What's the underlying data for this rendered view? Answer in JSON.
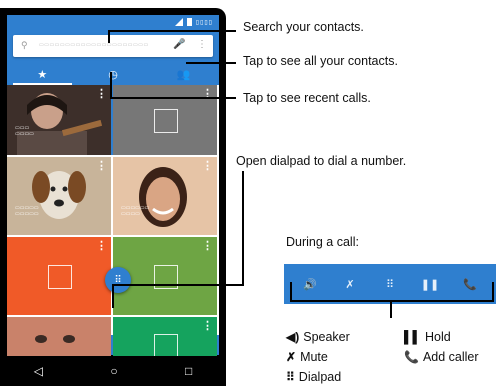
{
  "phone": {
    "statusbar": {
      "time": "▯▯▯▯"
    },
    "search": {
      "placeholder": "▭▭▭▭▭▭▭▭▭▭▭▭▭▭▭▭▭▭▭▭▭"
    },
    "tabs": [
      {
        "id": "favorites",
        "icon": "★"
      },
      {
        "id": "recents",
        "icon": "◷"
      },
      {
        "id": "contacts",
        "icon": "👥"
      }
    ],
    "tiles": [
      {
        "id": "tile-1",
        "color": "#3d2f2a",
        "name": "▭▭▭\n▭▭▭▭"
      },
      {
        "id": "tile-2",
        "color": "#777777"
      },
      {
        "id": "tile-3",
        "color": "#c8b49a",
        "name": "▭▭▭▭▭\n▭▭▭▭▭"
      },
      {
        "id": "tile-4",
        "color": "#d89a75",
        "name": "▭▭▭▭▭▭\n▭▭▭▭"
      },
      {
        "id": "tile-5",
        "color": "#f05a28"
      },
      {
        "id": "tile-6",
        "color": "#6ea544"
      },
      {
        "id": "tile-7",
        "color": "#d08a6f"
      },
      {
        "id": "tile-8",
        "color": "#15a35e"
      }
    ],
    "fab_icon": "⠿",
    "nav": {
      "back": "◁",
      "home": "○",
      "recents": "□"
    }
  },
  "callouts": {
    "search": "Search your contacts.",
    "all_contacts": "Tap to see all your contacts.",
    "recent_calls": "Tap to see recent calls.",
    "dialpad": "Open dialpad to dial a number."
  },
  "during_call": {
    "title": "During a call:",
    "icons": [
      "🔊",
      "✗",
      "⠿",
      "❚❚",
      "📞"
    ],
    "legend": {
      "speaker": {
        "icon": "◀)",
        "label": "Speaker"
      },
      "mute": {
        "icon": "✗",
        "label": "Mute"
      },
      "dialpad": {
        "icon": "⠿",
        "label": "Dialpad"
      },
      "hold": {
        "icon": "▌▌",
        "label": "Hold"
      },
      "add_caller": {
        "icon": "📞",
        "label": "Add caller"
      }
    }
  }
}
